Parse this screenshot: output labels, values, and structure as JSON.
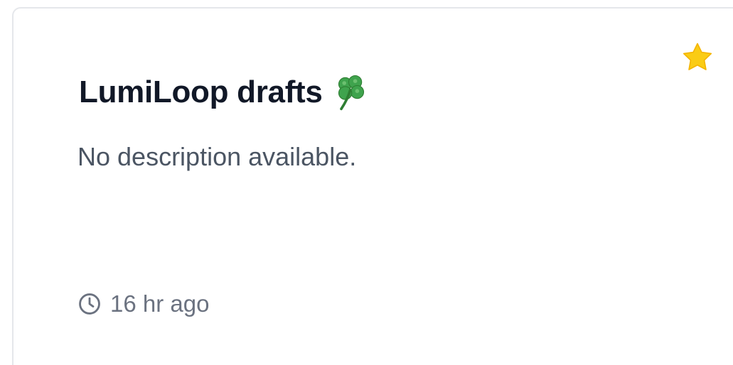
{
  "card": {
    "title": "LumiLoop drafts",
    "title_emoji_icon": "shamrock-icon",
    "description": "No description available.",
    "starred": true,
    "star_icon": "star-icon",
    "star_color": "#FACC15",
    "updated_icon": "clock-icon",
    "updated": "16 hr ago"
  }
}
